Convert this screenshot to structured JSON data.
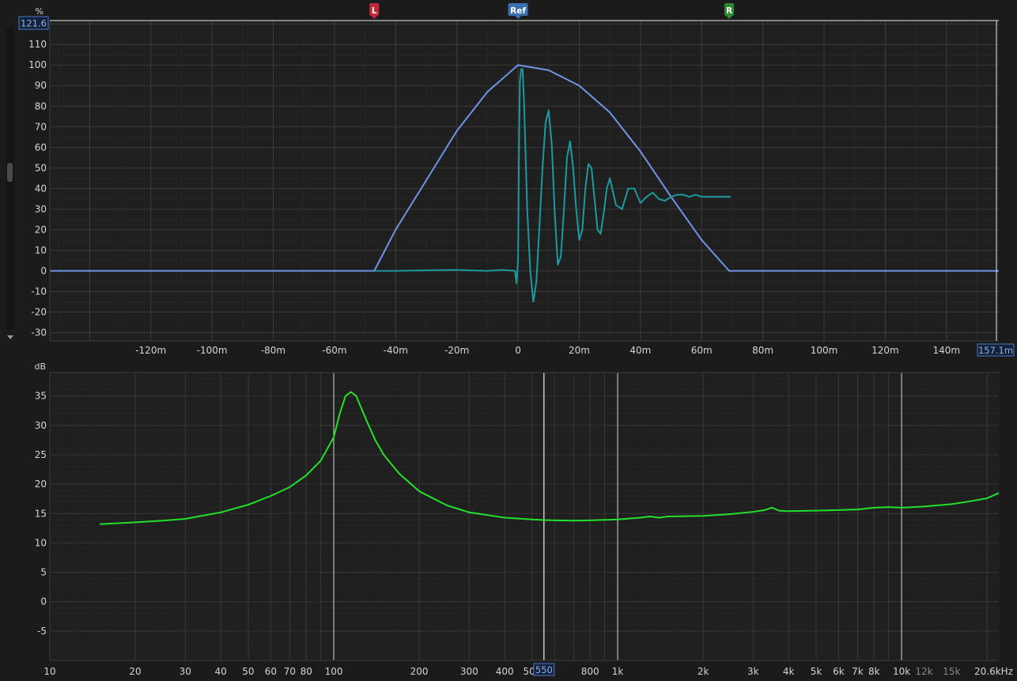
{
  "impulse": {
    "y_unit": "%",
    "y_max_readout": "121.6",
    "x_max_readout": "157.1m",
    "markers": {
      "left": "L",
      "ref": "Ref",
      "right": "R"
    },
    "marker_times_ms": {
      "left": -47,
      "ref": 0,
      "right": 69
    },
    "colors": {
      "window": "#6f95e6",
      "impulse": "#1d9aa0",
      "left_marker": "#c0283a",
      "ref_marker": "#3a6fb2",
      "right_marker": "#2a8a2f"
    }
  },
  "frequency": {
    "y_unit": "dB",
    "cursor_freq_readout": "550",
    "colors": {
      "magnitude": "#23e02a"
    }
  },
  "chart_data": [
    {
      "type": "line",
      "title": "",
      "xlabel": "",
      "ylabel": "%",
      "xlim_ms": [
        -153,
        157.1
      ],
      "ylim": [
        -34,
        121.6
      ],
      "x_ticks": [
        "-120m",
        "-100m",
        "-80m",
        "-60m",
        "-40m",
        "-20m",
        "0",
        "20m",
        "40m",
        "60m",
        "80m",
        "100m",
        "120m",
        "140m"
      ],
      "x_tick_values_ms": [
        -120,
        -100,
        -80,
        -60,
        -40,
        -20,
        0,
        20,
        40,
        60,
        80,
        100,
        120,
        140
      ],
      "y_ticks": [
        "110",
        "100",
        "90",
        "80",
        "70",
        "60",
        "50",
        "40",
        "30",
        "20",
        "10",
        "0",
        "-10",
        "-20",
        "-30"
      ],
      "y_tick_values": [
        110,
        100,
        90,
        80,
        70,
        60,
        50,
        40,
        30,
        20,
        10,
        0,
        -10,
        -20,
        -30
      ],
      "grid": true,
      "series": [
        {
          "kind": "window",
          "x_ms": [
            -153,
            -47,
            -40,
            -30,
            -20,
            -10,
            0,
            10,
            20,
            30,
            40,
            50,
            60,
            69,
            157.1
          ],
          "values": [
            0,
            0,
            20,
            44,
            68,
            87,
            100,
            97.5,
            90,
            77,
            58,
            36,
            15,
            0,
            0
          ]
        },
        {
          "kind": "impulse",
          "x_ms": [
            -47,
            -40,
            -30,
            -20,
            -10,
            -5,
            -1,
            -0.5,
            0,
            0.3,
            0.6,
            1,
            1.5,
            2,
            2.5,
            3,
            4,
            5,
            6,
            7,
            8,
            9,
            10,
            11,
            12,
            13,
            14,
            15,
            16,
            17,
            18,
            19,
            20,
            21,
            22,
            23,
            24,
            25,
            26,
            27,
            28,
            29,
            30,
            32,
            34,
            36,
            38,
            40,
            42,
            44,
            46,
            48,
            50,
            52,
            54,
            56,
            58,
            60,
            62,
            64,
            66,
            68,
            69.5
          ],
          "values": [
            0,
            0,
            0.3,
            0.5,
            0,
            0.5,
            0,
            -6,
            5,
            56,
            92,
            98,
            98,
            80,
            55,
            30,
            0,
            -15,
            -5,
            22,
            50,
            72,
            78,
            62,
            28,
            3,
            7,
            30,
            55,
            63,
            50,
            30,
            15,
            20,
            40,
            52,
            50,
            35,
            20,
            18,
            28,
            40,
            45,
            32,
            30,
            40,
            40,
            33,
            36,
            38,
            35,
            34,
            36,
            37,
            37,
            36,
            37,
            36,
            36,
            36,
            36,
            36,
            36
          ]
        }
      ]
    },
    {
      "type": "line",
      "title": "",
      "xlabel": "",
      "ylabel": "dB",
      "x_scale": "log",
      "xlim_hz": [
        10,
        22000
      ],
      "ylim": [
        -10,
        39
      ],
      "x_ticks": [
        "10",
        "20",
        "30",
        "40",
        "50",
        "60",
        "70",
        "80",
        "100",
        "200",
        "300",
        "400",
        "500",
        "800",
        "1k",
        "2k",
        "3k",
        "4k",
        "5k",
        "6k",
        "7k",
        "8k",
        "10k",
        "12k",
        "15k",
        "20.6kHz"
      ],
      "x_tick_values_hz": [
        10,
        20,
        30,
        40,
        50,
        60,
        70,
        80,
        100,
        200,
        300,
        400,
        500,
        800,
        1000,
        2000,
        3000,
        4000,
        5000,
        6000,
        7000,
        8000,
        10000,
        12000,
        15000,
        20600
      ],
      "y_ticks": [
        "35",
        "30",
        "25",
        "20",
        "15",
        "10",
        "5",
        "0",
        "-5"
      ],
      "y_tick_values": [
        35,
        30,
        25,
        20,
        15,
        10,
        5,
        0,
        -5
      ],
      "grid": true,
      "cursor_hz": 550,
      "series": [
        {
          "name": "",
          "x_hz": [
            15,
            20,
            25,
            30,
            40,
            50,
            60,
            70,
            80,
            90,
            100,
            105,
            110,
            115,
            120,
            130,
            140,
            150,
            170,
            200,
            250,
            300,
            400,
            500,
            550,
            600,
            700,
            800,
            1000,
            1200,
            1300,
            1400,
            1500,
            2000,
            2500,
            3000,
            3300,
            3500,
            3700,
            4000,
            5000,
            6000,
            7000,
            8000,
            9000,
            10000,
            12000,
            15000,
            17000,
            20000,
            22000
          ],
          "values": [
            13.2,
            13.5,
            13.8,
            14.1,
            15.2,
            16.5,
            18,
            19.5,
            21.5,
            24,
            28,
            32,
            35,
            35.7,
            35,
            31,
            27.5,
            25,
            21.8,
            18.8,
            16.4,
            15.2,
            14.3,
            14.0,
            13.9,
            13.85,
            13.8,
            13.85,
            14.0,
            14.3,
            14.5,
            14.3,
            14.5,
            14.6,
            14.9,
            15.3,
            15.6,
            16.0,
            15.5,
            15.4,
            15.5,
            15.6,
            15.7,
            16.0,
            16.1,
            16.0,
            16.2,
            16.6,
            17.0,
            17.6,
            18.5
          ]
        }
      ]
    }
  ]
}
